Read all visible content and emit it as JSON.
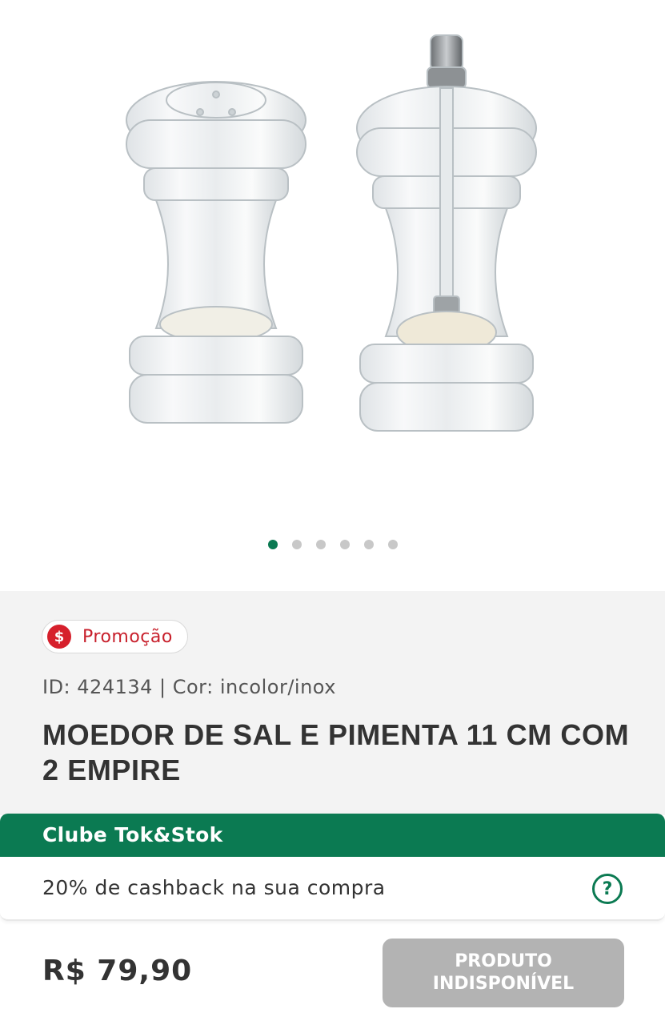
{
  "gallery": {
    "image_alt": "Moedor de sal e pimenta",
    "dots_total": 6,
    "active_index": 0
  },
  "promo": {
    "icon": "dollar-sign-icon",
    "label": "Promoção"
  },
  "product": {
    "meta": "ID: 424134 | Cor: incolor/inox",
    "title": "MOEDOR DE SAL E PIMENTA 11 CM COM 2 EMPIRE",
    "price": "R$ 79,90"
  },
  "club": {
    "title": "Clube Tok&Stok",
    "cashback": "20% de cashback na sua compra",
    "help_icon": "question-circle-icon"
  },
  "actions": {
    "unavailable_label": "PRODUTO\nINDISPONÍVEL"
  },
  "colors": {
    "brand_green": "#0b7a52",
    "promo_red": "#d6202c",
    "disabled_gray": "#b3b3b3"
  }
}
